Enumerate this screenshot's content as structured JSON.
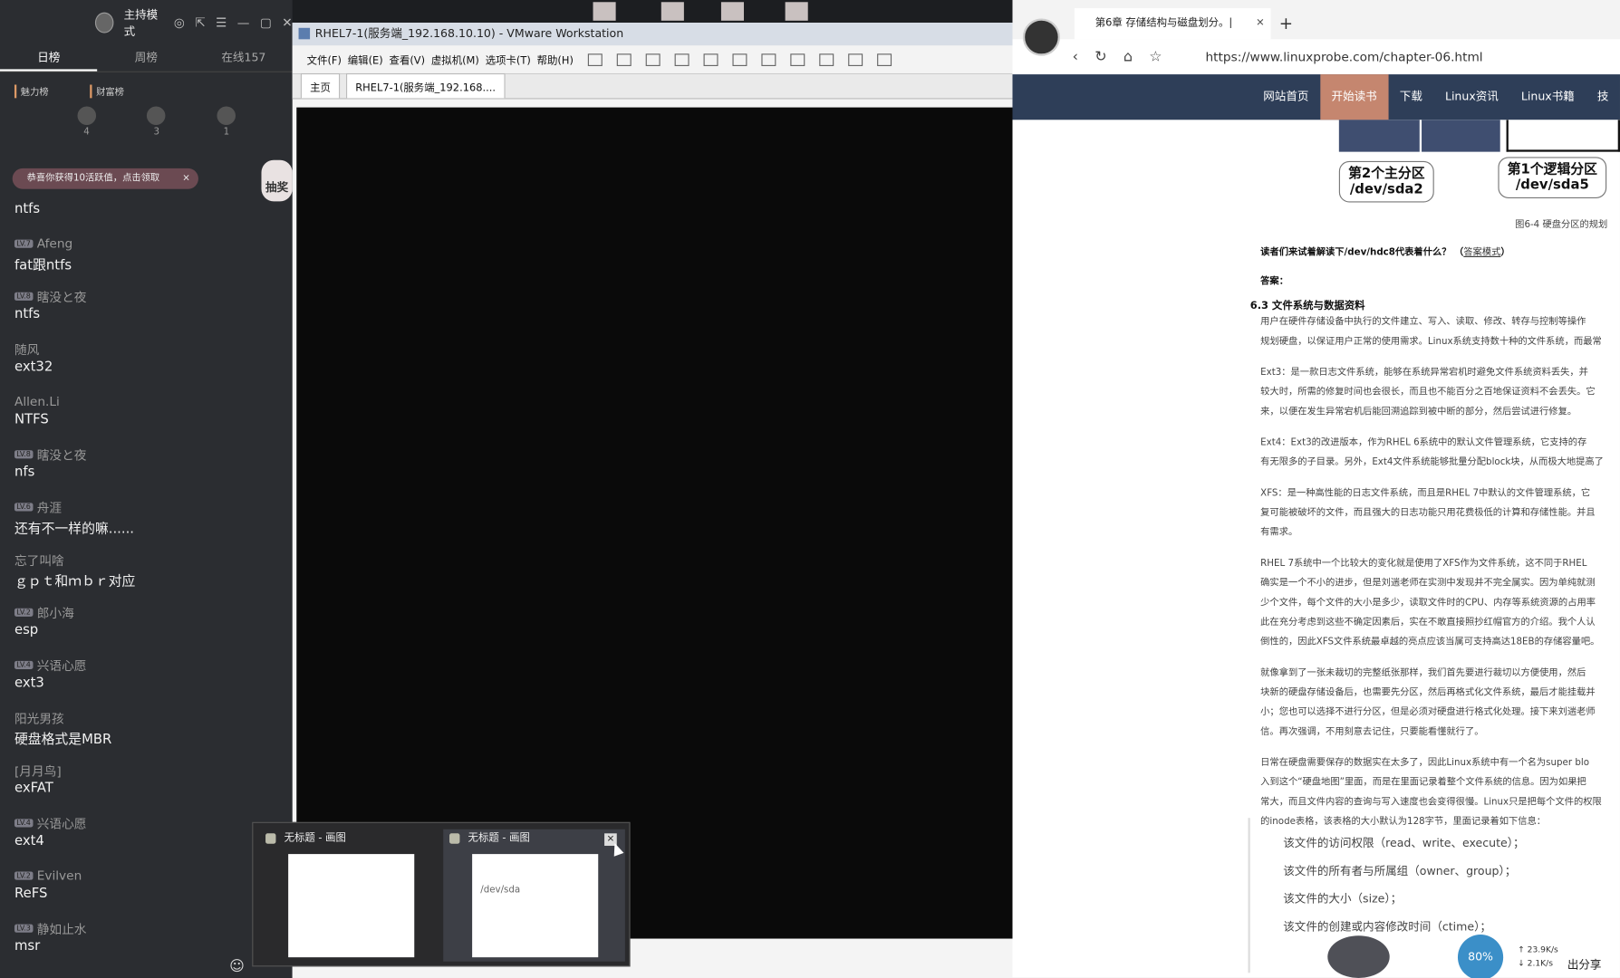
{
  "live_panel": {
    "host_mode": "主持模式",
    "tabs": [
      "日榜",
      "周榜",
      "在线157"
    ],
    "rank_labels": [
      "魅力榜",
      "财富榜"
    ],
    "rank_counts": [
      "4",
      "3",
      "1"
    ],
    "notice": "恭喜你获得10活跃值，点击领取",
    "gift_label": "抽奖",
    "messages": [
      {
        "level": "",
        "user": "",
        "text": "ntfs"
      },
      {
        "level": "LV.7",
        "user": "Afeng",
        "text": "fat跟ntfs"
      },
      {
        "level": "LV.8",
        "user": "瞎没と夜",
        "text": "ntfs"
      },
      {
        "level": "",
        "user": "随风",
        "text": "ext32"
      },
      {
        "level": "",
        "user": "Allen.Li",
        "text": "NTFS"
      },
      {
        "level": "LV.8",
        "user": "瞎没と夜",
        "text": "nfs"
      },
      {
        "level": "LV.6",
        "user": "舟涯",
        "text": "还有不一样的嘛......"
      },
      {
        "level": "",
        "user": "忘了叫啥",
        "text": "ｇｐｔ和ｍｂｒ对应"
      },
      {
        "level": "LV.2",
        "user": "郎小海",
        "text": "esp"
      },
      {
        "level": "LV.4",
        "user": "兴语心愿",
        "text": "ext3"
      },
      {
        "level": "",
        "user": "阳光男孩",
        "text": "硬盘格式是MBR"
      },
      {
        "level": "",
        "user": "[月月鸟]",
        "text": "exFAT"
      },
      {
        "level": "LV.4",
        "user": "兴语心愿",
        "text": "ext4"
      },
      {
        "level": "LV.2",
        "user": "Evilven",
        "text": "ReFS"
      },
      {
        "level": "LV.3",
        "user": "静如止水",
        "text": "msr"
      }
    ]
  },
  "vmware": {
    "title": "RHEL7-1(服务端_192.168.10.10) - VMware Workstation",
    "menu": [
      "文件(F)",
      "编辑(E)",
      "查看(V)",
      "虚拟机(M)",
      "选项卡(T)",
      "帮助(H)"
    ],
    "tabs": [
      "主页",
      "RHEL7-1(服务端_192.168...."
    ]
  },
  "browser": {
    "tab_title": "第6章 存储结构与磁盘划分。|",
    "url": "https://www.linuxprobe.com/chapter-06.html",
    "nav": [
      "网站首页",
      "开始读书",
      "下载",
      "Linux资讯",
      "Linux书籍",
      "技"
    ],
    "callouts": [
      {
        "name": "第2个主分区",
        "dev": "/dev/sda2"
      },
      {
        "name": "第1个逻辑分区",
        "dev": "/dev/sda5"
      }
    ],
    "caption": "图6-4 硬盘分区的规划",
    "question": "读者们来试着解读下/dev/hdc8代表着什么？",
    "question_link": "答案模式",
    "answer_label": "答案：",
    "section_title": "6.3 文件系统与数据资料",
    "paragraphs": [
      "用户在硬件存储设备中执行的文件建立、写入、读取、修改、转存与控制等操作",
      "规划硬盘，以保证用户正常的使用需求。Linux系统支持数十种的文件系统，而最常",
      "Ext3：是一款日志文件系统，能够在系统异常宕机时避免文件系统资料丢失，并",
      "较大时，所需的修复时间也会很长，而且也不能百分之百地保证资料不会丢失。它",
      "来，以便在发生异常宕机后能回溯追踪到被中断的部分，然后尝试进行修复。",
      "Ext4：Ext3的改进版本，作为RHEL 6系统中的默认文件管理系统，它支持的存",
      "有无限多的子目录。另外，Ext4文件系统能够批量分配block块，从而极大地提高了",
      "XFS：是一种高性能的日志文件系统，而且是RHEL 7中默认的文件管理系统，它",
      "复可能被破坏的文件，而且强大的日志功能只用花费极低的计算和存储性能。并且",
      "有需求。",
      "RHEL 7系统中一个比较大的变化就是使用了XFS作为文件系统，这不同于RHEL",
      "确实是一个不小的进步，但是刘遄老师在实测中发现并不完全属实。因为单纯就测",
      "少个文件，每个文件的大小是多少，读取文件时的CPU、内存等系统资源的占用率",
      "此在充分考虑到这些不确定因素后，实在不敢直接照抄红帽官方的介绍。我个人认",
      "倒性的，因此XFS文件系统最卓越的亮点应该当属可支持高达18EB的存储容量吧。",
      "就像拿到了一张未裁切的完整纸张那样，我们首先要进行裁切以方便使用，然后",
      "块新的硬盘存储设备后，也需要先分区，然后再格式化文件系统，最后才能挂载并",
      "小；您也可以选择不进行分区，但是必须对硬盘进行格式化处理。接下来刘遄老师",
      "信。再次强调，不用刻意去记住，只要能看懂就行了。",
      "日常在硬盘需要保存的数据实在太多了，因此Linux系统中有一个名为super blo",
      "入到这个“硬盘地图”里面，而是在里面记录着整个文件系统的信息。因为如果把",
      "常大，而且文件内容的查询与写入速度也会变得很慢。Linux只是把每个文件的权限",
      "的inode表格，该表格的大小默认为128字节，里面记录着如下信息："
    ],
    "list_items": [
      "该文件的访问权限（read、write、execute）；",
      "该文件的所有者与所属组（owner、group）；",
      "该文件的大小（size）；",
      "该文件的创建或内容修改时间（ctime）；"
    ]
  },
  "taskbar_popup": {
    "windows": [
      "无标题 - 画图",
      "无标题 - 画图"
    ],
    "preview_text": "/dev/sda"
  },
  "status": {
    "cpu": "80%",
    "up": "23.9K/s",
    "down": "2.1K/s",
    "share": "出分享"
  }
}
